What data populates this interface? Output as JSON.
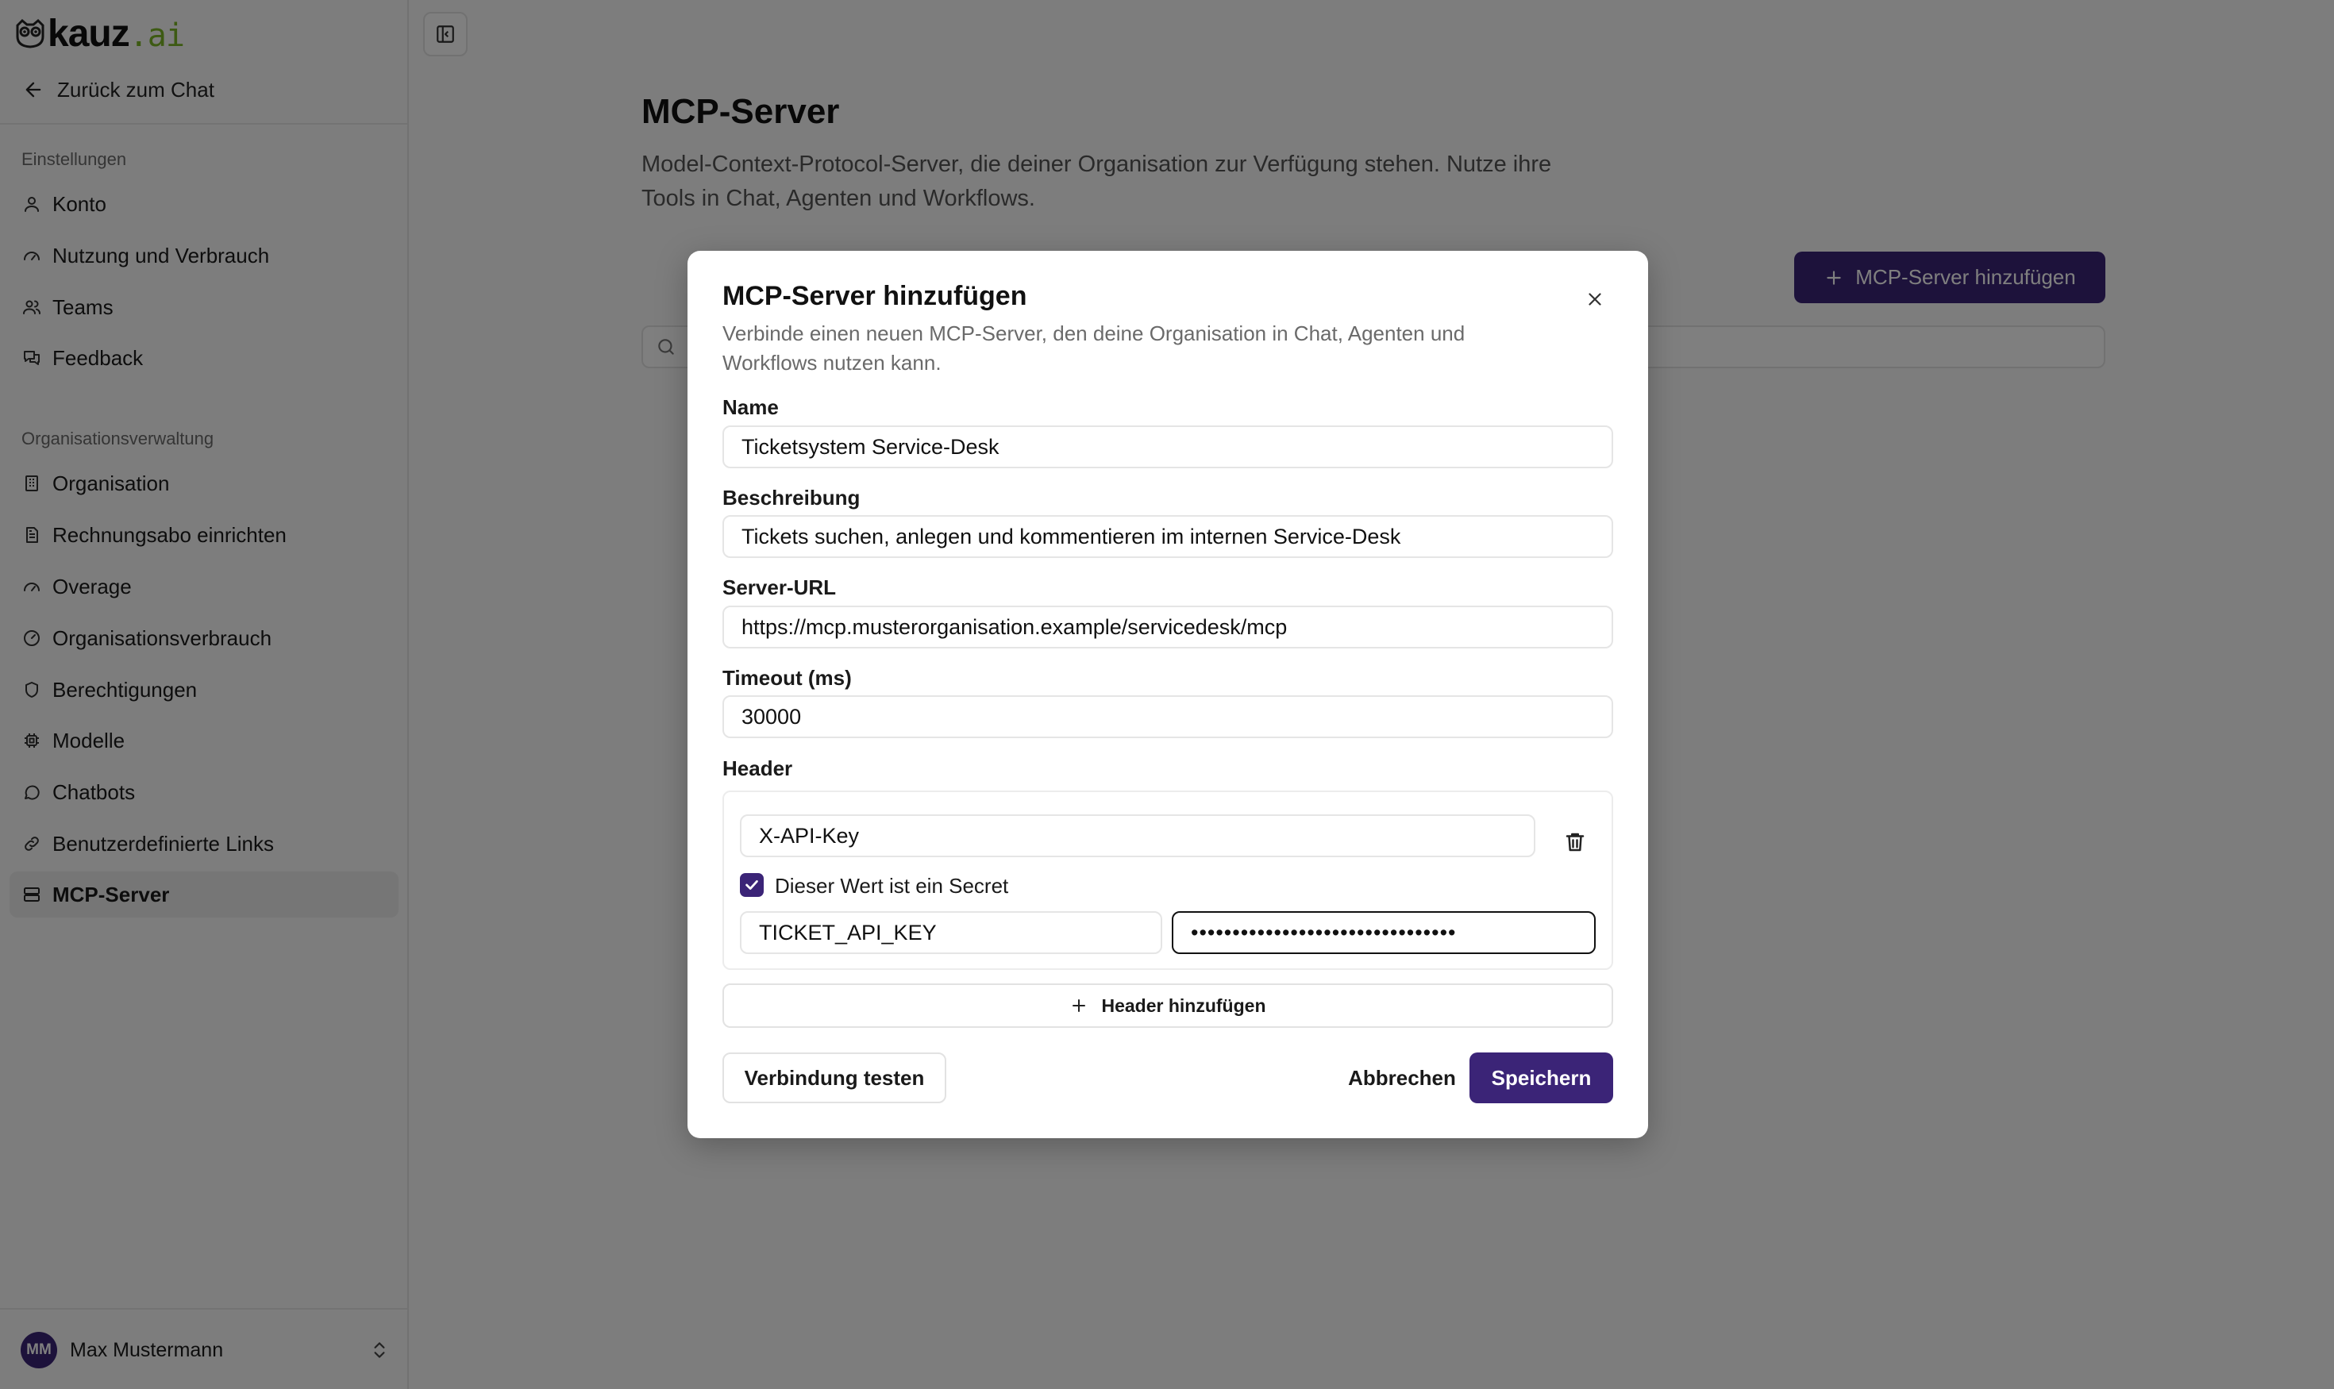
{
  "brand": {
    "name": "kauz",
    "suffix": ".ai",
    "accent": "#7ab526",
    "primary": "#3b2477"
  },
  "sidebar": {
    "back_label": "Zurück zum Chat",
    "section_settings": "Einstellungen",
    "settings_items": [
      {
        "label": "Konto",
        "icon": "user-icon"
      },
      {
        "label": "Nutzung und Verbrauch",
        "icon": "gauge-icon"
      },
      {
        "label": "Teams",
        "icon": "users-icon"
      },
      {
        "label": "Feedback",
        "icon": "messages-icon"
      }
    ],
    "section_org": "Organisationsverwaltung",
    "org_items": [
      {
        "label": "Organisation",
        "icon": "building-icon"
      },
      {
        "label": "Rechnungsabo einrichten",
        "icon": "receipt-icon"
      },
      {
        "label": "Overage",
        "icon": "gauge-icon"
      },
      {
        "label": "Organisationsverbrauch",
        "icon": "gauge-circle-icon"
      },
      {
        "label": "Berechtigungen",
        "icon": "shield-icon"
      },
      {
        "label": "Modelle",
        "icon": "cpu-icon"
      },
      {
        "label": "Chatbots",
        "icon": "message-circle-icon"
      },
      {
        "label": "Benutzerdefinierte Links",
        "icon": "link-icon"
      },
      {
        "label": "MCP-Server",
        "icon": "server-icon",
        "active": true
      }
    ],
    "user": {
      "initials": "MM",
      "name": "Max Mustermann"
    }
  },
  "main": {
    "title": "MCP-Server",
    "description": "Model-Context-Protocol-Server, die deiner Organisation zur Verfügung stehen. Nutze ihre Tools in Chat, Agenten und Workflows.",
    "add_button": "MCP-Server hinzufügen"
  },
  "dialog": {
    "title": "MCP-Server hinzufügen",
    "description": "Verbinde einen neuen MCP-Server, den deine Organisation in Chat, Agenten und Workflows nutzen kann.",
    "name_label": "Name",
    "name_value": "Ticketsystem Service-Desk",
    "description_label": "Beschreibung",
    "description_value": "Tickets suchen, anlegen und kommentieren im internen Service-Desk",
    "url_label": "Server-URL",
    "url_value": "https://mcp.musterorganisation.example/servicedesk/mcp",
    "timeout_label": "Timeout (ms)",
    "timeout_value": "30000",
    "header_label": "Header",
    "header_key": "X-API-Key",
    "secret_checkbox_label": "Dieser Wert ist ein Secret",
    "secret_checked": true,
    "secret_name": "TICKET_API_KEY",
    "secret_value": "••••••••••••••••••••••••••••••••",
    "add_header_label": "Header hinzufügen",
    "test_label": "Verbindung testen",
    "cancel_label": "Abbrechen",
    "save_label": "Speichern"
  }
}
